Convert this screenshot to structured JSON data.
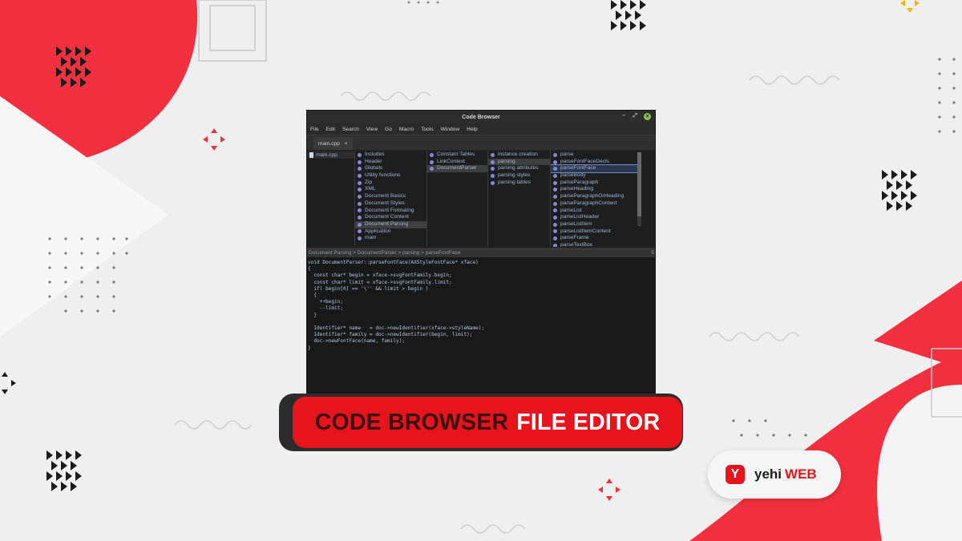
{
  "window": {
    "title": "Code Browser",
    "menu": [
      "File",
      "Edit",
      "Search",
      "View",
      "Go",
      "Macro",
      "Tools",
      "Window",
      "Help"
    ],
    "tab": {
      "label": "main.cpp",
      "close": "×"
    },
    "minimize": "–",
    "maximize": "⤢",
    "close": "×"
  },
  "browser": {
    "files": [
      "main.cpp"
    ],
    "sections": [
      "Includes",
      "Header",
      "Globals",
      "Utility functions",
      "Zip",
      "XML",
      "Document Basics",
      "Document Styles",
      "Document Formating",
      "Document Content",
      "Document Parsing",
      "Application",
      "main"
    ],
    "classes": [
      "Constant Tables",
      "LinkContext",
      "DocumentParser"
    ],
    "categories": [
      "instance creation",
      "parsing",
      "parsing attributes",
      "parsing styles",
      "parsing tables"
    ],
    "methods": [
      "parse",
      "parseFontFaceDecls",
      "parseFontFace",
      "parseBody",
      "parseParagraph",
      "parseHeading",
      "parseParagraphOrHeading",
      "parseParagraphContent",
      "parseList",
      "parseListHeader",
      "parseListItem",
      "parseListItemContent",
      "parseFrame",
      "parseTextBox"
    ]
  },
  "breadcrumb": "Document Parsing > DocumentParser > parsing > parseFontFace",
  "breadcrumb_right": "5",
  "code": [
    "void DocumentParser::parseFontFace(AXStyleFontFace* xface)",
    "{",
    "  const char* begin = xface->svgFontFamily.begin;",
    "  const char* limit = xface->svgFontFamily.limit;",
    "  if( begin[0] == '\\'' && limit > begin )",
    "  {",
    "    ++begin;",
    "    --limit;",
    "  }",
    "",
    "  Identifier* name   = doc->newIdentifier(xface->styleName);",
    "  Identifier* family = doc->newIdentifier(begin, limit);",
    "  doc->newFontFace(name, family);",
    "}"
  ],
  "banner": {
    "part1": "CODE BROWSER",
    "part2": "FILE EDITOR"
  },
  "logo": {
    "badge": "Y",
    "part1": "yehi",
    "part2": "WEB"
  },
  "colors": {
    "accent": "#e5141d",
    "dark": "#2c2c2c",
    "background": "#efeff0"
  }
}
